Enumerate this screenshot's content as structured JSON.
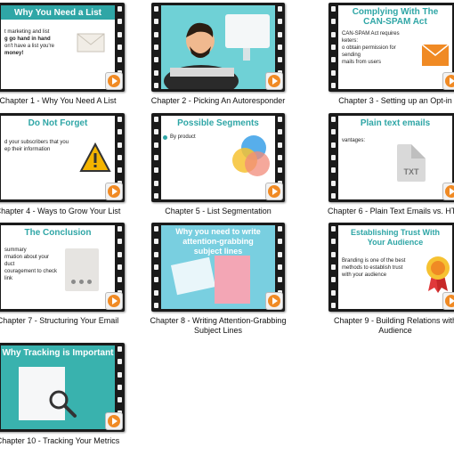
{
  "tiles": [
    {
      "caption": "Chapter 1 - Why You Need A List",
      "title": "Why You Need a List",
      "lines": [
        "t marketing and list",
        "g go hand in hand",
        "on't have a list you're",
        "money!"
      ]
    },
    {
      "caption": "Chapter 2 - Picking An Autoresponder"
    },
    {
      "caption": "Chapter 3 - Setting up an Opt-in",
      "title": "Complying With The CAN-SPAM Act",
      "lines": [
        "CAN-SPAM Act requires",
        "keters:",
        "o obtain permission for sending",
        "mails from users"
      ]
    },
    {
      "caption": "Chapter 4 - Ways to Grow Your List",
      "title": "Do Not Forget",
      "lines": [
        "d your subscribers that you",
        "ep their information"
      ]
    },
    {
      "caption": "Chapter 5 - List Segmentation",
      "title": "Possible Segments",
      "lines": [
        "By product"
      ]
    },
    {
      "caption": "Chapter 6 - Plain Text Emails vs. HTM",
      "title": "Plain text emails",
      "lines": [
        "vantages:"
      ],
      "doc_label": "TXT"
    },
    {
      "caption": "Chapter 7 - Structuring Your Email",
      "title": "The Conclusion",
      "lines": [
        "summary",
        "rmation about your",
        "duct",
        "couragement to check",
        "link"
      ]
    },
    {
      "caption": "Chapter 8 - Writing Attention-Grabbing Subject Lines",
      "title": "Why you need to write attention-grabbing subject lines"
    },
    {
      "caption": "Chapter 9 - Building Relations with Audience",
      "title": "Establishing Trust With Your Audience",
      "lines": [
        "Branding is one of the best",
        "methods to establish trust",
        "with your audience"
      ]
    },
    {
      "caption": "Chapter 10 - Tracking Your Metrics",
      "title": "Why Tracking is Important"
    }
  ],
  "colors": {
    "teal": "#2fa6a6",
    "orange": "#f08a24",
    "film": "#1a1a1a"
  },
  "icons": [
    "envelope-icon",
    "warning-icon",
    "venn-icon",
    "txt-file-icon",
    "document-icon",
    "award-ribbon-icon",
    "magnifier-icon",
    "play-icon"
  ]
}
